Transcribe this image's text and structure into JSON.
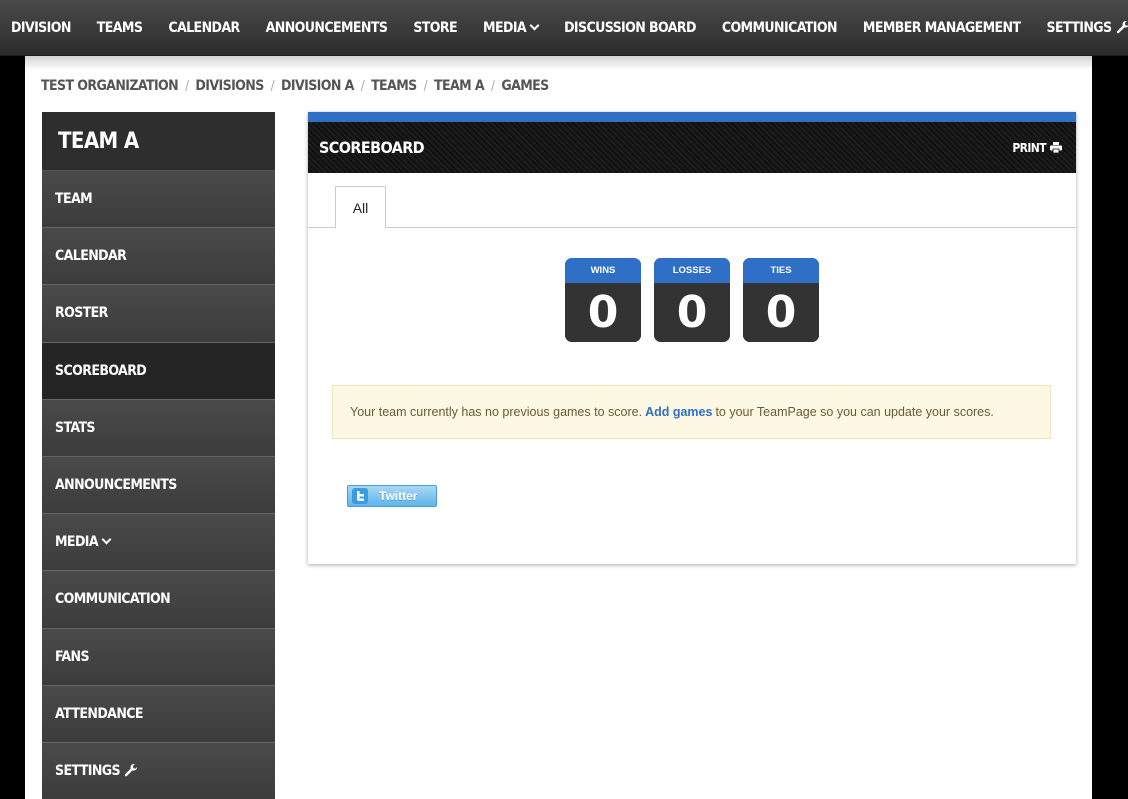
{
  "topnav": {
    "items": [
      "DIVISION",
      "TEAMS",
      "CALENDAR",
      "ANNOUNCEMENTS",
      "STORE",
      "MEDIA",
      "DISCUSSION BOARD",
      "COMMUNICATION",
      "MEMBER MANAGEMENT"
    ],
    "settings": "SETTINGS"
  },
  "breadcrumb": [
    "TEST ORGANIZATION",
    "DIVISIONS",
    "DIVISION A",
    "TEAMS",
    "TEAM A",
    "GAMES"
  ],
  "sidebar": {
    "title": "TEAM A",
    "items": [
      "TEAM",
      "CALENDAR",
      "ROSTER",
      "SCOREBOARD",
      "STATS",
      "ANNOUNCEMENTS",
      "MEDIA",
      "COMMUNICATION",
      "FANS",
      "ATTENDANCE",
      "SETTINGS"
    ],
    "active": "SCOREBOARD"
  },
  "panel": {
    "title": "SCOREBOARD",
    "print_label": "PRINT",
    "tab": "All",
    "scores": [
      {
        "label": "WINS",
        "value": "0"
      },
      {
        "label": "LOSSES",
        "value": "0"
      },
      {
        "label": "TIES",
        "value": "0"
      }
    ],
    "notice": {
      "before": "Your team currently has no previous games to score.",
      "link": "Add games",
      "after": "to your TeamPage so you can update your scores."
    },
    "twitter_label": "Twitter"
  },
  "colors": {
    "accent": "#2f6fc6",
    "notice_bg": "#fcf8e3"
  }
}
